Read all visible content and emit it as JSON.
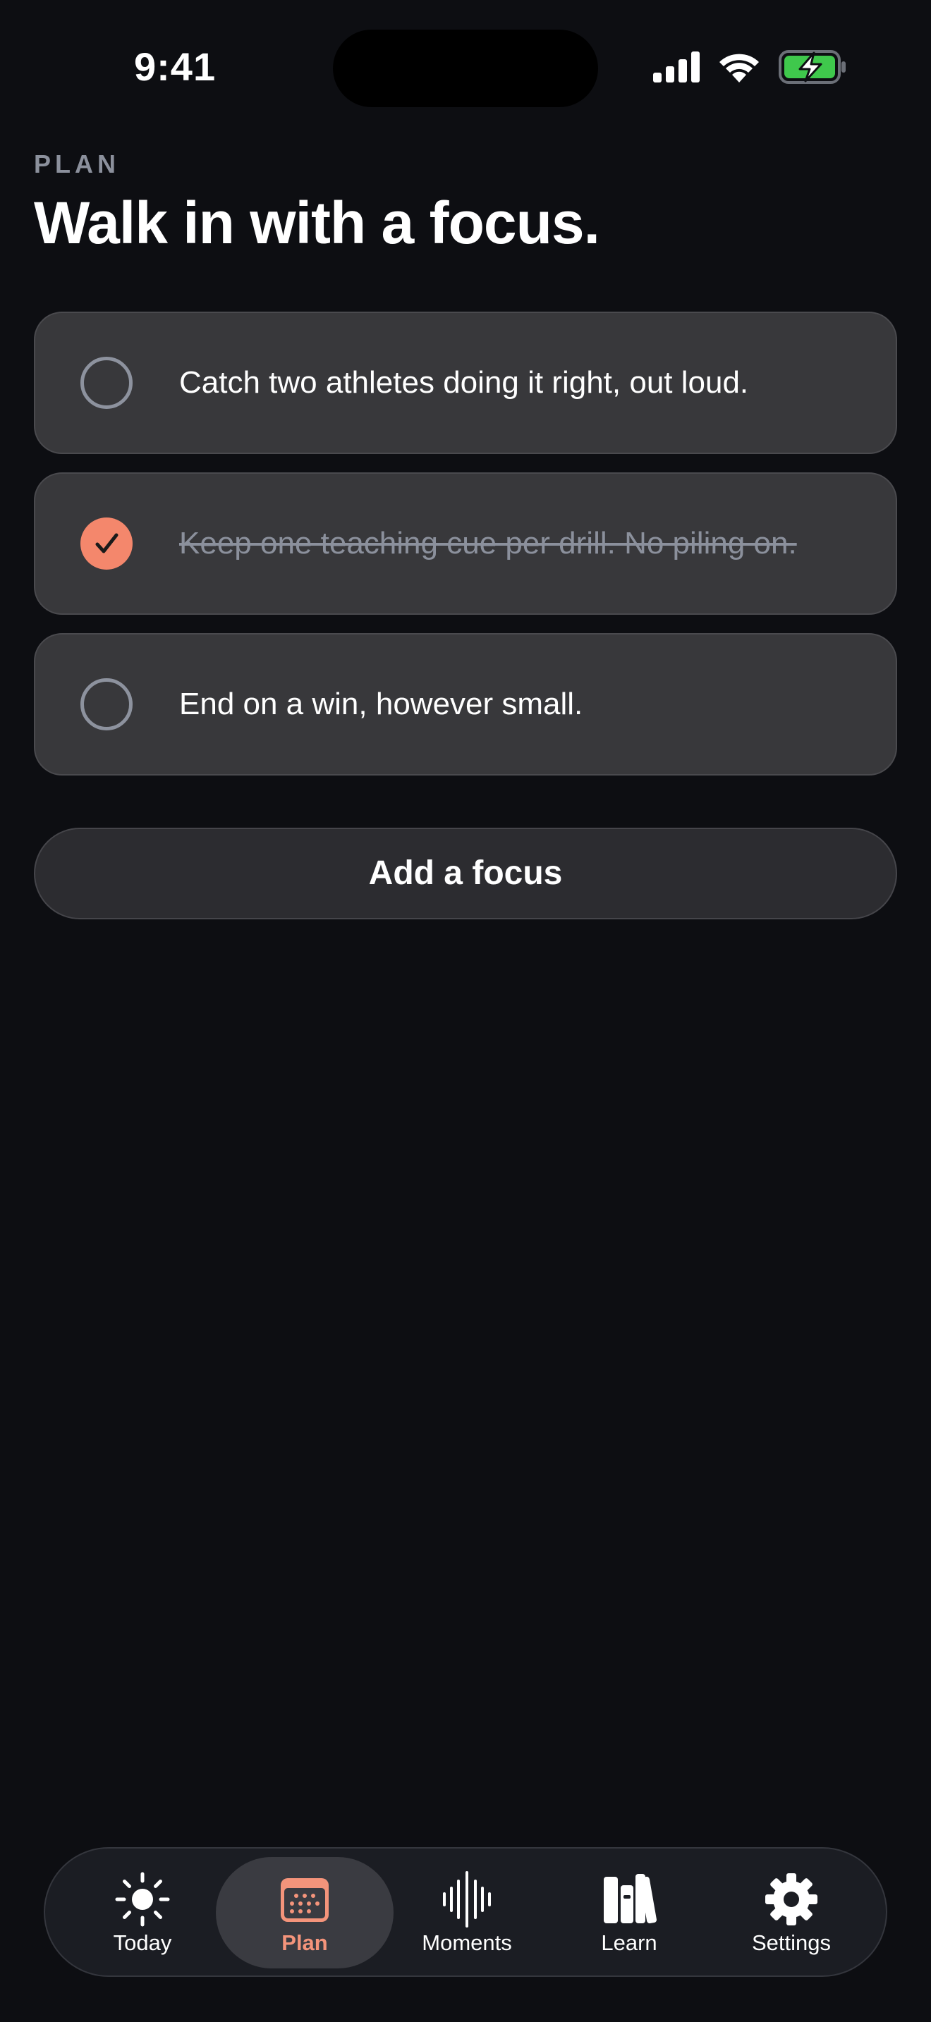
{
  "status_bar": {
    "time": "9:41",
    "icons": [
      "cellular-signal-icon",
      "wifi-icon",
      "battery-charging-icon"
    ],
    "battery_color": "#3fc84c"
  },
  "header": {
    "eyebrow": "PLAN",
    "title": "Walk in with a focus."
  },
  "focus_items": [
    {
      "text": "Catch two athletes doing it right, out loud.",
      "done": false
    },
    {
      "text": "Keep one teaching cue per drill. No piling on.",
      "done": true
    },
    {
      "text": "End on a win, however small.",
      "done": false
    }
  ],
  "add_button": {
    "label": "Add a focus"
  },
  "tabs": [
    {
      "label": "Today",
      "icon": "sun-icon",
      "active": false
    },
    {
      "label": "Plan",
      "icon": "calendar-icon",
      "active": true
    },
    {
      "label": "Moments",
      "icon": "waveform-icon",
      "active": false
    },
    {
      "label": "Learn",
      "icon": "books-icon",
      "active": false
    },
    {
      "label": "Settings",
      "icon": "gear-icon",
      "active": false
    }
  ],
  "colors": {
    "background": "#0d0e12",
    "card": "#38383b",
    "accent": "#f4876c",
    "muted_text": "#8b909c"
  }
}
